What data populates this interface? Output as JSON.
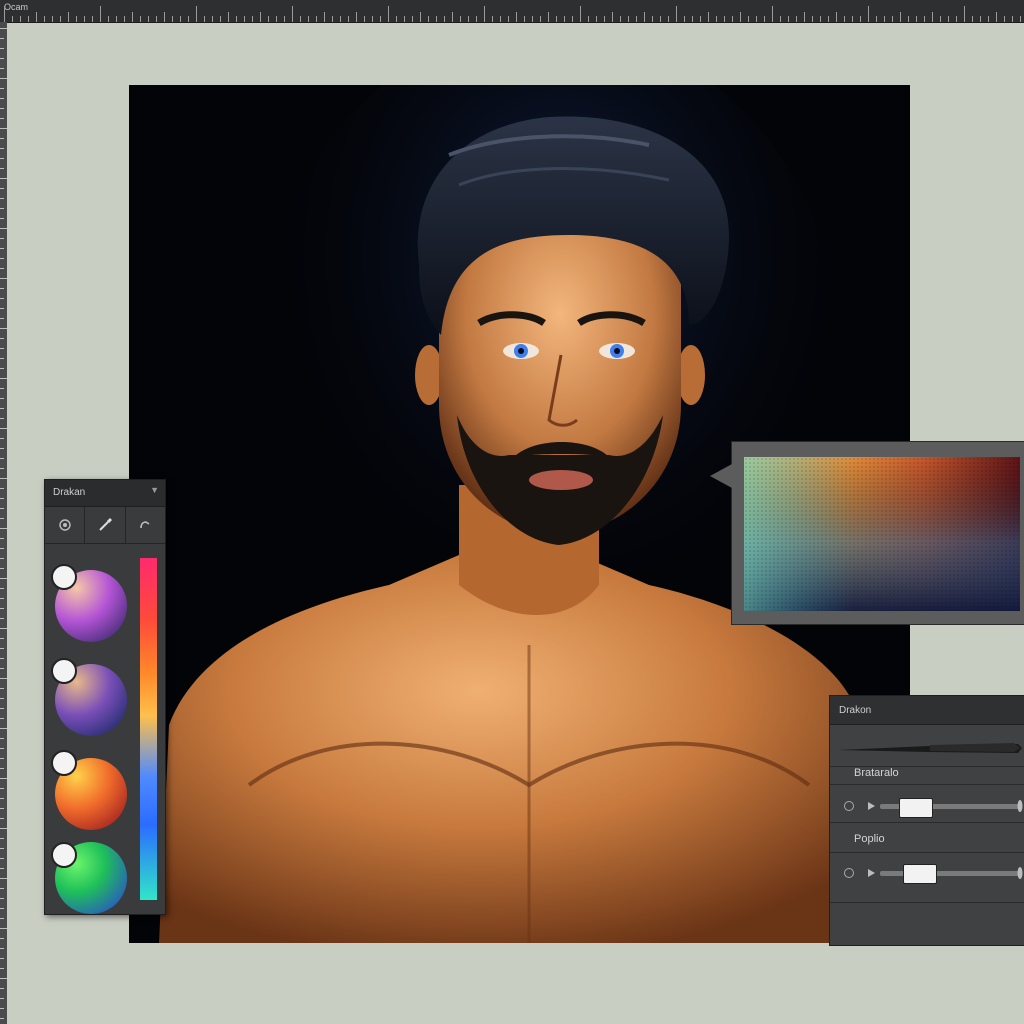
{
  "ruler_top": {
    "label": "Ocam"
  },
  "swatch_panel": {
    "title": "Drakan",
    "tools": [
      {
        "name": "target-icon"
      },
      {
        "name": "brush-icon"
      },
      {
        "name": "hand-icon"
      }
    ],
    "swatches": [
      {
        "name": "purple-swatch",
        "colors": [
          "#f6c7a8",
          "#b454d6",
          "#3b2a6d"
        ]
      },
      {
        "name": "violet-swatch",
        "colors": [
          "#e8b98a",
          "#7a4fb8",
          "#1c2a6a"
        ]
      },
      {
        "name": "orange-swatch",
        "colors": [
          "#ffd24a",
          "#f06a2a",
          "#9c1e22"
        ]
      },
      {
        "name": "green-swatch",
        "colors": [
          "#6cf56a",
          "#1fbf5a",
          "#2b42d8"
        ]
      }
    ]
  },
  "gradient_popup": {
    "colors": [
      "#e8d07a",
      "#e6953e",
      "#c6582c",
      "#8a1f1e",
      "#31206e",
      "#2a8fb0",
      "#6ac8b8"
    ]
  },
  "adjust_panel": {
    "title": "Drakon",
    "row1_label": "Brataralo",
    "row2_label": "Poplio",
    "slider1_value": 0.25,
    "slider2_value": 0.28
  },
  "artboard": {
    "background": "#030408",
    "skin": "#c8783e",
    "hair": "#141a28",
    "eyes": "#3f7ff0"
  }
}
